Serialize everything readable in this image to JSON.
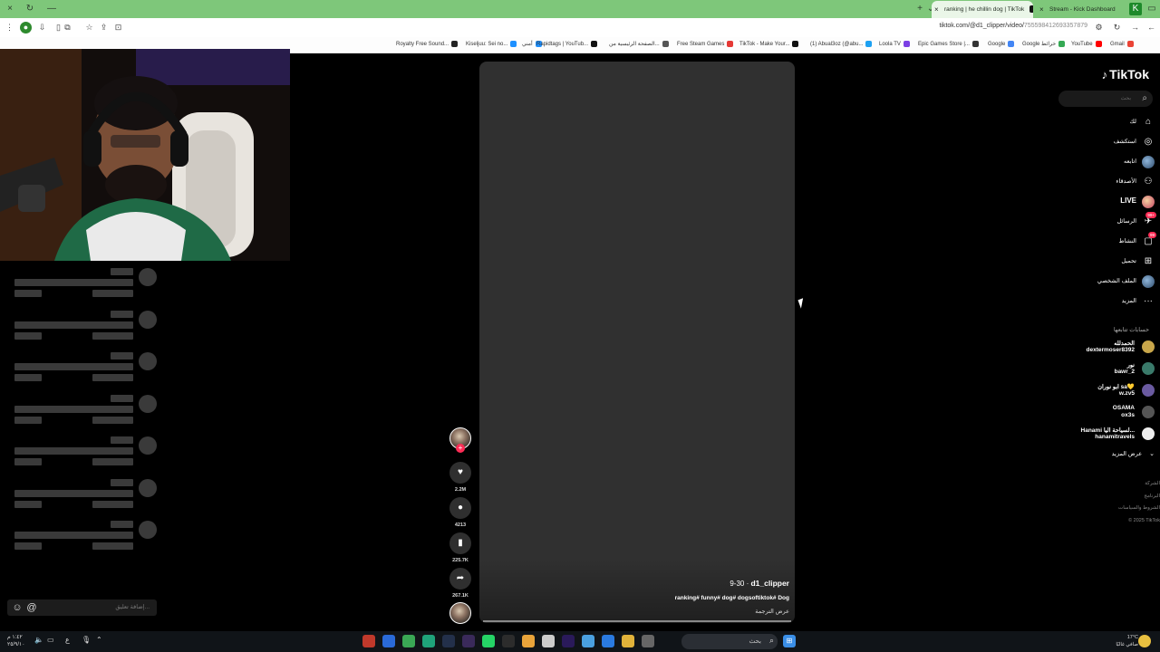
{
  "browser": {
    "tabs": [
      {
        "title": "ranking | he chillin dog | TikTok",
        "active": true
      },
      {
        "title": "Stream - Kick Dashboard",
        "active": false
      }
    ],
    "url_main": "tiktok.com/@d1_clipper/video/",
    "url_dim": "755598412693357879",
    "bookmarks": [
      {
        "label": "Royalty Free Sound...",
        "color": "#222222"
      },
      {
        "label": "Kiseljuu: Sei no...",
        "color": "#1e90ff"
      },
      {
        "label": "أمني",
        "color": "#1e90ff"
      },
      {
        "label": "Rapidtags | YouTub...",
        "color": "#111111"
      },
      {
        "label": "الصفحة الرئيسية من...",
        "color": "#555555"
      },
      {
        "label": "Free Steam Games",
        "color": "#e53935"
      },
      {
        "label": "TikTok - Make Your...",
        "color": "#111111"
      },
      {
        "label": "(1) Abual3oz (@abu...",
        "color": "#1da1f2"
      },
      {
        "label": "Loola TV",
        "color": "#7b3fe4"
      },
      {
        "label": "Epic Games Store |...",
        "color": "#333333"
      },
      {
        "label": "Google",
        "color": "#4285f4"
      },
      {
        "label": "Google خرائط",
        "color": "#34a853"
      },
      {
        "label": "YouTube",
        "color": "#ff0000"
      },
      {
        "label": "Gmail",
        "color": "#ea4335"
      }
    ]
  },
  "chat": {
    "input_placeholder": "إضافة تعليق...",
    "emoji_icon": "☺",
    "mention_icon": "@"
  },
  "video": {
    "username": "d1_clipper",
    "date": "9-30",
    "caption": "ranking# funny# dog# dogsoftiktok# Dog",
    "translate": "عرض الترجمة",
    "likes": "2.2M",
    "comments": "4213",
    "saves": "225.7K",
    "shares": "267.1K"
  },
  "tiktok": {
    "logo": "TikTok",
    "search_placeholder": "بحث",
    "nav": [
      {
        "label": "لك",
        "icon": "home-icon",
        "glyph": "⌂",
        "big": false
      },
      {
        "label": "استكشف",
        "icon": "compass-icon",
        "glyph": "◎",
        "big": false
      },
      {
        "label": "اتابعه",
        "icon": "following-avatar",
        "glyph": "",
        "big": false
      },
      {
        "label": "الأصدقاء",
        "icon": "friends-icon",
        "glyph": "⚇",
        "big": false
      },
      {
        "label": "LIVE",
        "icon": "live-icon",
        "glyph": "",
        "big": true
      },
      {
        "label": "الرسائل",
        "icon": "messages-icon",
        "glyph": "✈",
        "big": false,
        "badge": "99+"
      },
      {
        "label": "النشاط",
        "icon": "activity-icon",
        "glyph": "▢",
        "big": false,
        "badge": "99"
      },
      {
        "label": "تحميل",
        "icon": "upload-icon",
        "glyph": "⊞",
        "big": false
      },
      {
        "label": "الملف الشخصي",
        "icon": "profile-avatar",
        "glyph": "",
        "big": false
      },
      {
        "label": "المزيد",
        "icon": "more-icon",
        "glyph": "···",
        "big": false
      }
    ],
    "following_heading": "حسابات تتابعها",
    "following": [
      {
        "name": "الحمدلله",
        "handle": "dextermoser8392",
        "color": "#c8a64a"
      },
      {
        "name": "نور",
        "handle": "bawr_2",
        "color": "#3a7a6a"
      },
      {
        "name": "ابو نوران sa💛",
        "handle": "w.zv5",
        "color": "#6a5aa0"
      },
      {
        "name": "OSAMA",
        "handle": "ox3s",
        "color": "#555555"
      },
      {
        "name": "Hanami لسياحة اليا...",
        "handle": "hanamitravels",
        "color": "#eeeeee"
      }
    ],
    "see_more": "عرض المزيد",
    "footer": [
      "الشركة",
      "البرنامج",
      "الشروط والسياسات",
      "© 2025 TikTok"
    ]
  },
  "taskbar": {
    "search_placeholder": "بحث",
    "time": "١:٤٢ م",
    "date": "٢٥/٩/١٠",
    "lang": "ع",
    "weather_temp": "17°C",
    "weather_desc": "صافي غالبًا",
    "apps": [
      {
        "name": "app-icon-1",
        "color": "#c0392b"
      },
      {
        "name": "app-icon-2",
        "color": "#2a6ad8"
      },
      {
        "name": "app-icon-3",
        "color": "#3aa855"
      },
      {
        "name": "app-icon-4",
        "color": "#1fa37a"
      },
      {
        "name": "app-icon-5",
        "color": "#23304a"
      },
      {
        "name": "app-icon-6",
        "color": "#3a2a5a"
      },
      {
        "name": "whatsapp-icon",
        "color": "#25d366"
      },
      {
        "name": "app-icon-8",
        "color": "#2c2c2c"
      },
      {
        "name": "chrome-icon",
        "color": "#e8a33a"
      },
      {
        "name": "app-icon-10",
        "color": "#cccccc"
      },
      {
        "name": "premiere-icon",
        "color": "#2a1a5a"
      },
      {
        "name": "app-icon-12",
        "color": "#4aa0e0"
      },
      {
        "name": "app-icon-13",
        "color": "#2a7ae0"
      },
      {
        "name": "folder-icon",
        "color": "#e0b23a"
      },
      {
        "name": "app-icon-15",
        "color": "#666666"
      }
    ]
  }
}
